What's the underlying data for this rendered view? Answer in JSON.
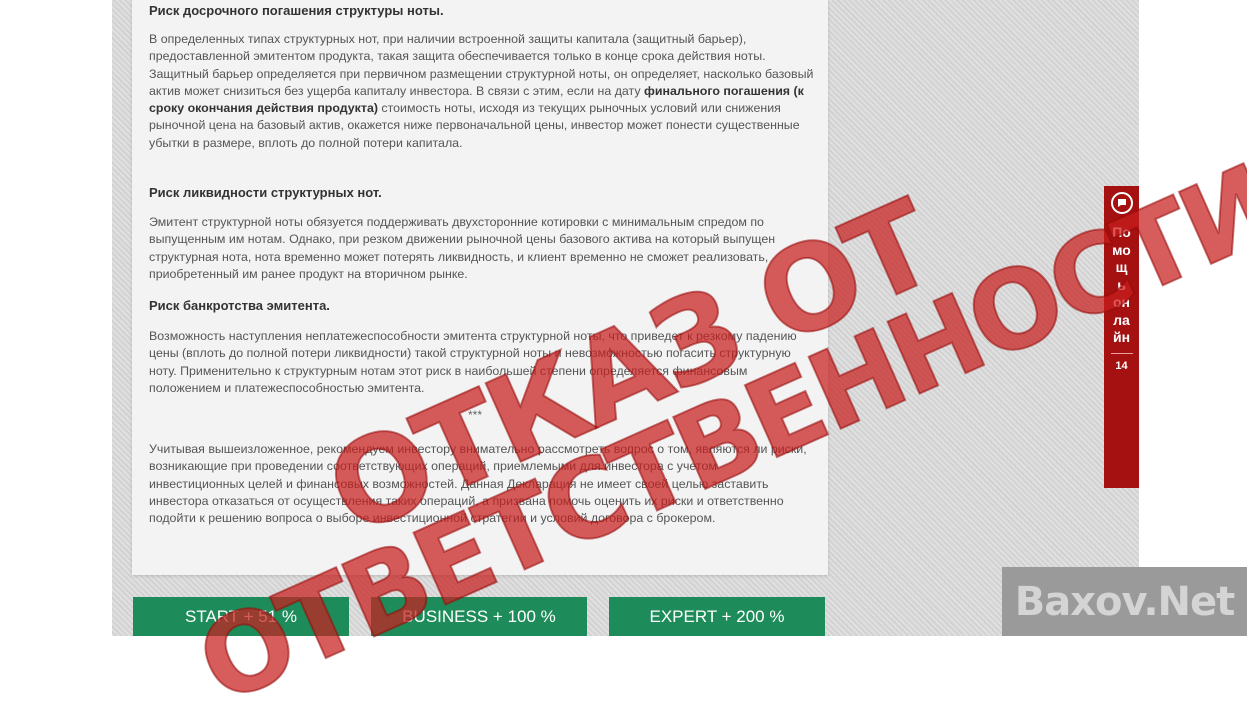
{
  "article": {
    "heading_early": "Риск досрочного погашения структуры ноты.",
    "para_early_1": "В определенных типах структурных нот, при наличии встроенной защиты капитала (защитный барьер), предоставленной эмитентом продукта, такая защита обеспечивается только в конце срока действия ноты. Защитный барьер определяется при первичном размещении структурной ноты, он определяет, насколько базовый актив может снизиться без ущерба капиталу инвестора. В связи с этим, если на дату",
    "para_early_bold": "финального погашения (к сроку окончания действия продукта)",
    "para_early_2": " стоимость ноты, исходя из текущих рыночных условий или снижения рыночной цена на базовый актив, окажется ниже первоначальной цены, инвестор может понести существенные убытки в размере, вплоть до полной потери капитала.",
    "heading_liquidity": "Риск ликвидности структурных нот.",
    "para_liquidity": "Эмитент структурной ноты обязуется поддерживать двухсторонние котировки с минимальным спредом по выпущенным им нотам. Однако, при резком движении рыночной цены базового актива на который выпущен структурная нота, нота временно может потерять ликвидность, и клиент временно не сможет реализовать, приобретенный им ранее продукт на вторичном рынке.",
    "heading_bankruptcy": "Риск банкротства эмитента.",
    "para_bankruptcy": "Возможность наступления неплатежеспособности эмитента структурной ноты, что приведет к резкому падению цены (вплоть до полной потери ликвидности) такой структурной ноты и невозможностью погасить структурную ноту. Применительно к структурным нотам этот риск в наибольшей степени определяется финансовым положением и платежеспособностью эмитента.",
    "separator": "***",
    "para_conclusion": "Учитывая вышеизложенное, рекомендуем инвестору внимательно рассмотреть вопрос о том, являются ли риски, возникающие при проведении соответствующих операций, приемлемыми для инвестора с учетом инвестиционных целей и финансовых возможностей. Данная Декларация не имеет своей целью заставить инвестора отказаться от осуществления таких операций, а призвана помочь оценить их риски и ответственно подойти к решению вопроса о выборе инвестиционной стратегии и условий договора с брокером."
  },
  "plans": [
    {
      "label": "START + 51 %"
    },
    {
      "label": "BUSINESS + 100 %"
    },
    {
      "label": "EXPERT + 200 %"
    }
  ],
  "help_widget": {
    "icon": "chat-bubble-icon",
    "label": "Помощь онлайн",
    "count": "14"
  },
  "stamp": {
    "line1": "ОТКАЗ ОТ",
    "line2": "ОТВЕТСТВЕННОСТИ"
  },
  "watermark": "Baxov.Net",
  "colors": {
    "plan_button": "#1e8c5a",
    "help_tab": "#a51111",
    "stamp": "#c81e1e"
  }
}
